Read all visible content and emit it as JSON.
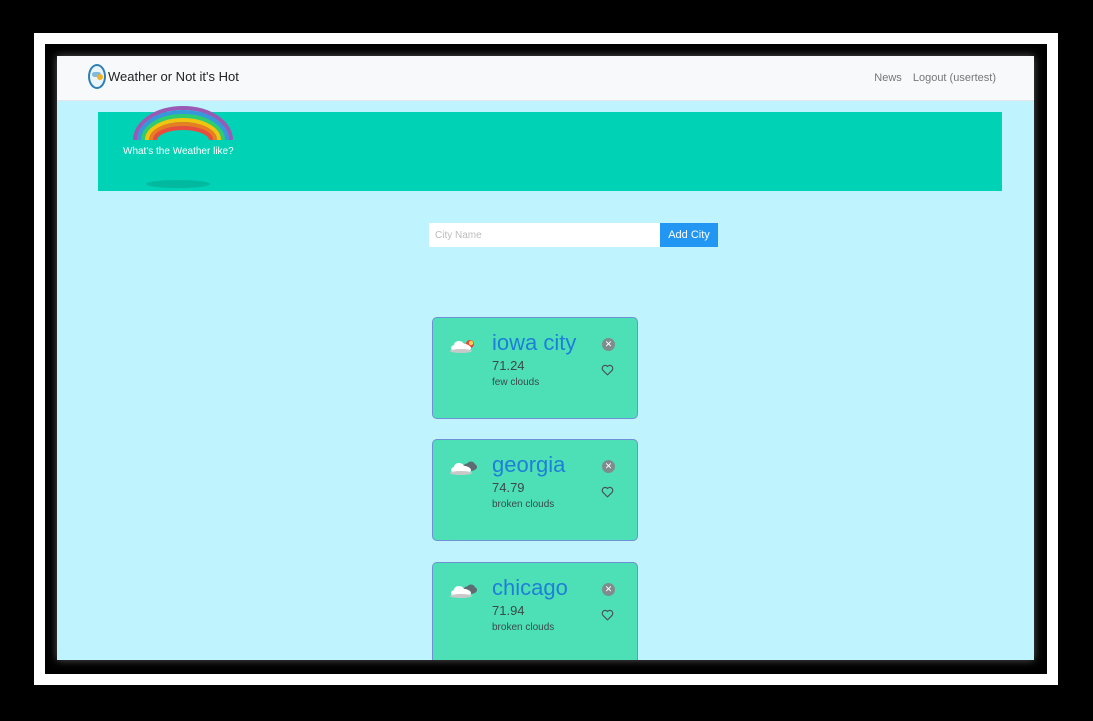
{
  "navbar": {
    "brand": "Weather or Not it's Hot",
    "links": [
      "News",
      "Logout (usertest)"
    ]
  },
  "jumbotron": {
    "text": "What's the Weather like?"
  },
  "search": {
    "placeholder": "City Name",
    "value": "",
    "button_label": "Add City"
  },
  "cards": [
    {
      "city": "iowa city",
      "temp": "71.24",
      "description": "few clouds",
      "icon": "partly-sunny-icon"
    },
    {
      "city": "georgia",
      "temp": "74.79",
      "description": "broken clouds",
      "icon": "broken-clouds-icon"
    },
    {
      "city": "chicago",
      "temp": "71.94",
      "description": "broken clouds",
      "icon": "broken-clouds-icon"
    }
  ],
  "colors": {
    "page_background": "#bff3fd",
    "jumbotron": "#00d3b5",
    "card": "#4de0b7",
    "city_text": "#1e7fd6",
    "button": "#2196f3"
  }
}
